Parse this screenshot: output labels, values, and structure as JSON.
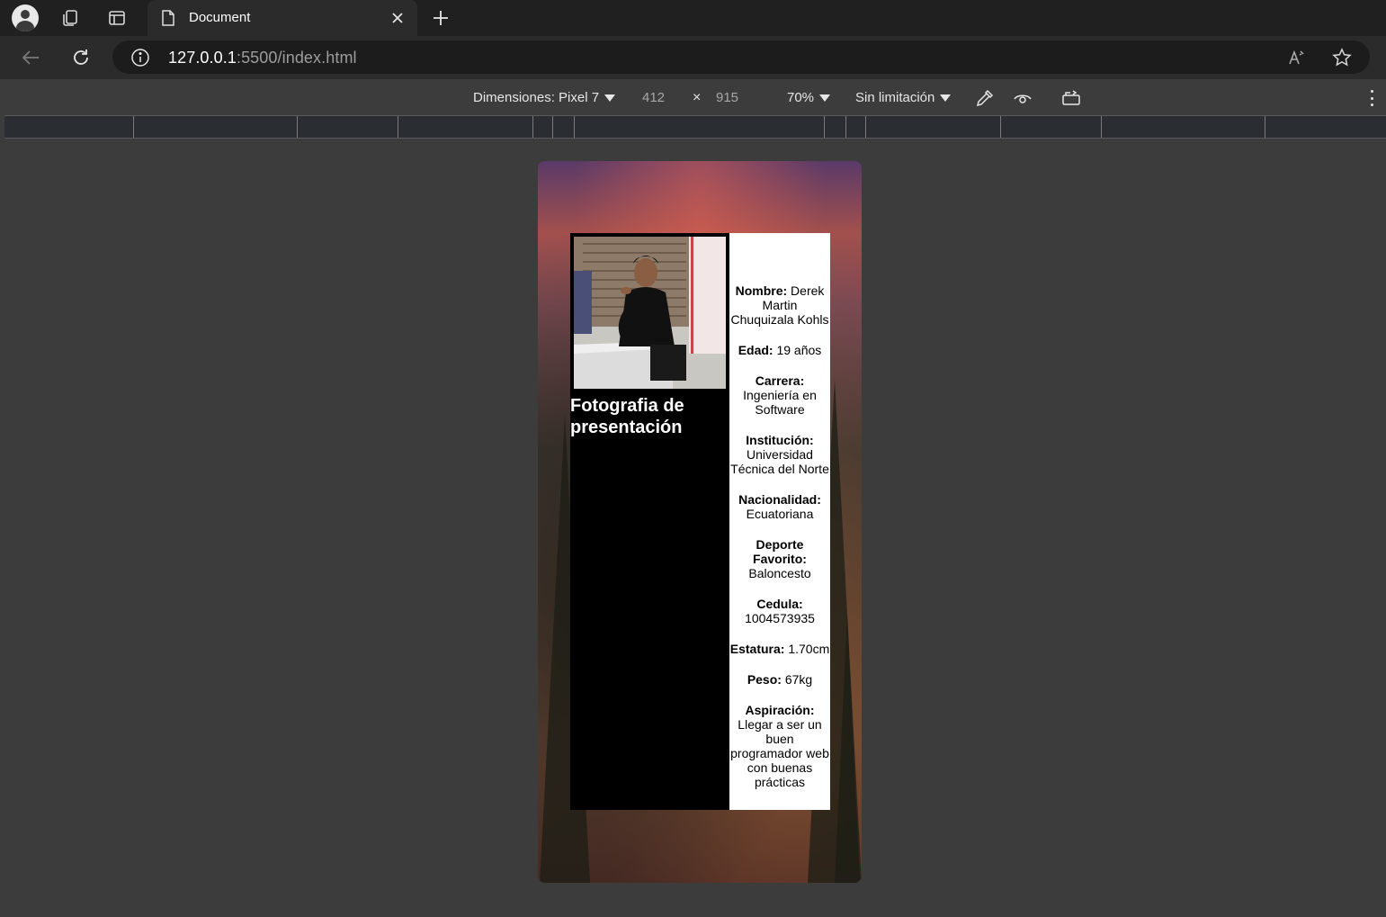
{
  "browser": {
    "tab_title": "Document",
    "url_host": "127.0.0.1",
    "url_rest": ":5500/index.html"
  },
  "devtools": {
    "dimensions_label": "Dimensiones: Pixel 7",
    "width": "412",
    "times": "×",
    "height": "915",
    "zoom": "70%",
    "throttling": "Sin limitación"
  },
  "page": {
    "photo_caption": "Fotografia de presentación",
    "fields": [
      {
        "label": "Nombre:",
        "value": "Derek Martin Chuquizala Kohls"
      },
      {
        "label": "Edad:",
        "value": "19 años"
      },
      {
        "label": "Carrera:",
        "value": "Ingeniería en Software"
      },
      {
        "label": "Institución:",
        "value": "Universidad Técnica del Norte"
      },
      {
        "label": "Nacionalidad:",
        "value": "Ecuatoriana"
      },
      {
        "label": "Deporte Favorito:",
        "value": "Baloncesto"
      },
      {
        "label": "Cedula:",
        "value": "1004573935"
      },
      {
        "label": "Estatura:",
        "value": "1.70cm"
      },
      {
        "label": "Peso:",
        "value": "67kg"
      },
      {
        "label": "Aspiración:",
        "value": "Llegar a ser un buen programador web con buenas prácticas"
      }
    ]
  }
}
